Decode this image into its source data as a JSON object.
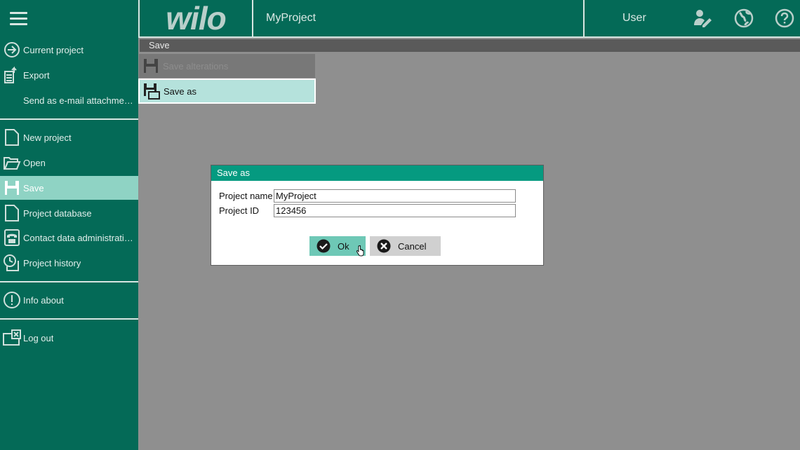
{
  "header": {
    "logo": "wilo",
    "project_title": "MyProject",
    "user_label": "User",
    "icons": [
      "edit-user-icon",
      "globe-icon",
      "help-icon"
    ]
  },
  "sidebar": {
    "items": [
      {
        "label": "Current project",
        "icon": "arrow-circle-icon"
      },
      {
        "label": "Export",
        "icon": "export-icon"
      },
      {
        "label": "Send as e-mail attachment…",
        "icon": ""
      },
      {
        "label": "New project",
        "icon": "new-document-icon"
      },
      {
        "label": "Open",
        "icon": "folder-open-icon"
      },
      {
        "label": "Save",
        "icon": "save-icon"
      },
      {
        "label": "Project database",
        "icon": "database-icon"
      },
      {
        "label": "Contact data administration",
        "icon": "phone-icon"
      },
      {
        "label": "Project history",
        "icon": "history-icon"
      },
      {
        "label": "Info about",
        "icon": "info-icon"
      },
      {
        "label": "Log out",
        "icon": "logout-icon"
      }
    ],
    "active": "Save"
  },
  "subbar": {
    "title": "Save"
  },
  "submenu": {
    "items": [
      {
        "label": "Save alterations",
        "state": "disabled"
      },
      {
        "label": "Save as",
        "state": "selected"
      }
    ]
  },
  "dialog": {
    "title": "Save as",
    "fields": [
      {
        "label": "Project name",
        "value": "MyProject"
      },
      {
        "label": "Project ID",
        "value": "123456"
      }
    ],
    "ok_label": "Ok",
    "cancel_label": "Cancel"
  },
  "colors": {
    "brand_green": "#046a57",
    "dialog_title": "#059a80",
    "active_item": "#8fd3c4",
    "ok_button": "#6ec8b6"
  }
}
